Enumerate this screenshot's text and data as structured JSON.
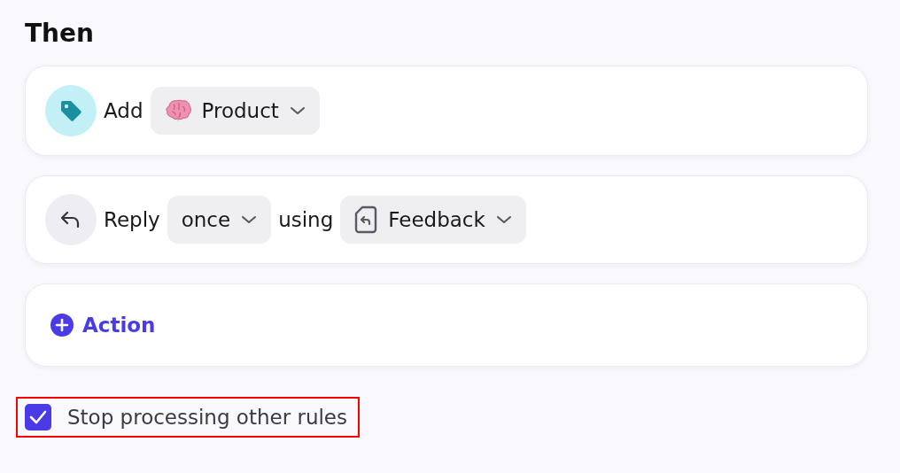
{
  "section_title": "Then",
  "actions": [
    {
      "kind": "tag",
      "parts": [
        {
          "kind": "word",
          "text": "Add"
        },
        {
          "kind": "brain_select",
          "text": "Product"
        }
      ]
    },
    {
      "kind": "reply",
      "parts": [
        {
          "kind": "word",
          "text": "Reply"
        },
        {
          "kind": "select",
          "text": "once"
        },
        {
          "kind": "word",
          "text": "using"
        },
        {
          "kind": "template_select",
          "text": "Feedback"
        }
      ]
    }
  ],
  "add_action": {
    "label": "Action"
  },
  "stop_option": {
    "label": "Stop processing other rules",
    "checked": true,
    "highlighted": true
  }
}
